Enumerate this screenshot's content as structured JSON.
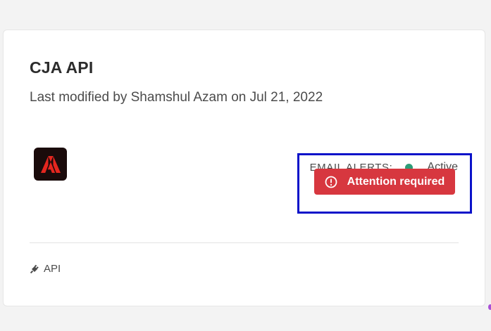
{
  "card": {
    "title": "CJA API",
    "subtitle": "Last modified by Shamshul Azam on Jul 21, 2022"
  },
  "logo": {
    "icon": "adobe-logo-icon",
    "background": "#1a0b0b",
    "accent": "#e5261f"
  },
  "email_alerts": {
    "label": "EMAIL ALERTS:",
    "status": "Active",
    "status_color": "#2d9d78"
  },
  "attention": {
    "label": "Attention required",
    "icon": "alert-circle-icon",
    "color": "#d7373f"
  },
  "highlight": {
    "color": "#0a12c9"
  },
  "footer": {
    "icon": "plug-icon",
    "label": "API"
  }
}
